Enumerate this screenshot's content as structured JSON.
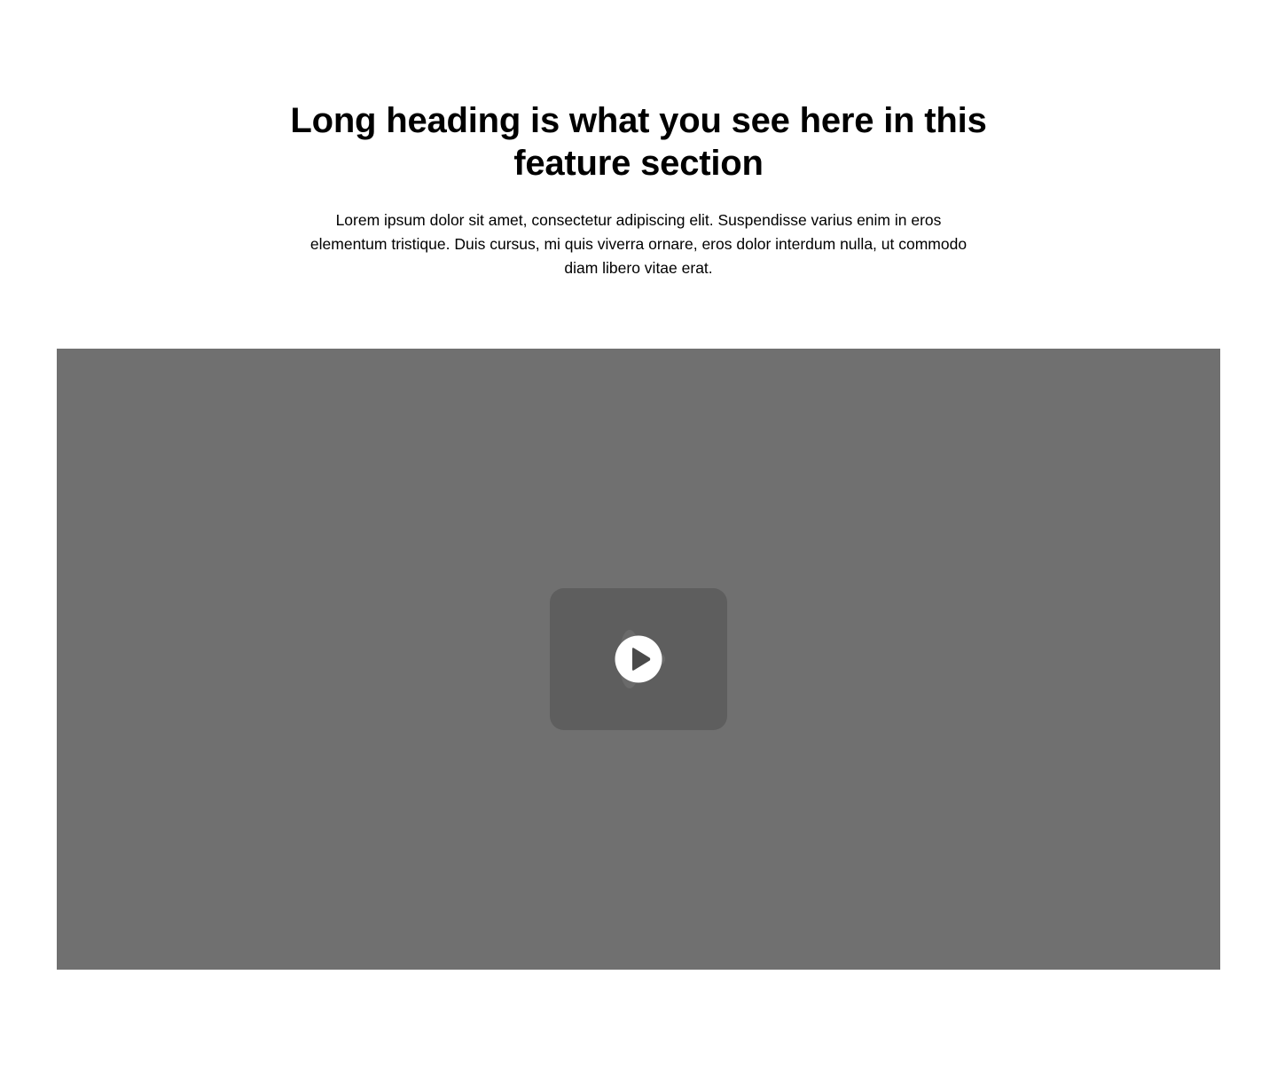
{
  "feature": {
    "heading": "Long heading is what you see here in this feature section",
    "description": "Lorem ipsum dolor sit amet, consectetur adipiscing elit. Suspendisse varius enim in eros elementum tristique. Duis cursus, mi quis viverra ornare, eros dolor interdum nulla, ut commodo diam libero vitae erat."
  },
  "video": {
    "background_color": "#707070",
    "play_card_color": "#5e5e5e",
    "play_icon": "play-icon"
  }
}
